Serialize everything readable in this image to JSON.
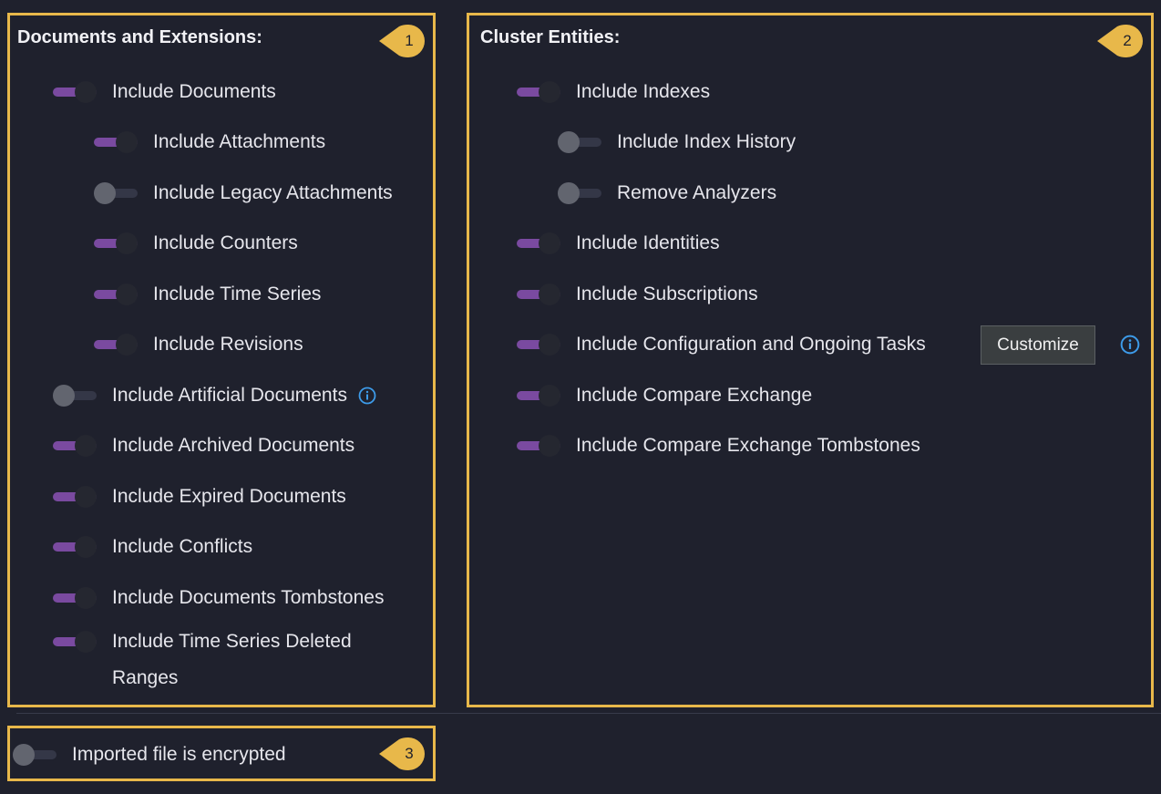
{
  "colors": {
    "background": "#1f212d",
    "highlight_border": "#e8b84a",
    "toggle_on": "#7a4aa0",
    "toggle_off": "#343747",
    "info_icon": "#3d9be9"
  },
  "documents": {
    "title": "Documents and Extensions:",
    "badge": "1",
    "items": [
      {
        "label": "Include Documents",
        "on": true
      },
      {
        "label": "Include Attachments",
        "on": true
      },
      {
        "label": "Include Legacy Attachments",
        "on": false
      },
      {
        "label": "Include Counters",
        "on": true
      },
      {
        "label": "Include Time Series",
        "on": true
      },
      {
        "label": "Include Revisions",
        "on": true
      },
      {
        "label": "Include Artificial Documents",
        "on": false,
        "icon": "info-icon"
      },
      {
        "label": "Include Archived Documents",
        "on": true
      },
      {
        "label": "Include Expired Documents",
        "on": true
      },
      {
        "label": "Include Conflicts",
        "on": true
      },
      {
        "label": "Include Documents Tombstones",
        "on": true
      },
      {
        "label": "Include Time Series Deleted",
        "on": true
      },
      {
        "label": "Ranges"
      }
    ]
  },
  "cluster": {
    "title": "Cluster Entities:",
    "badge": "2",
    "items": [
      {
        "label": "Include Indexes",
        "on": true
      },
      {
        "label": "Include Index History",
        "on": false
      },
      {
        "label": "Remove Analyzers",
        "on": false
      },
      {
        "label": "Include Identities",
        "on": true
      },
      {
        "label": "Include Subscriptions",
        "on": true
      },
      {
        "label": "Include Configuration and Ongoing Tasks",
        "on": true
      },
      {
        "label": "Include Compare Exchange",
        "on": true
      },
      {
        "label": "Include Compare Exchange Tombstones",
        "on": true
      }
    ],
    "customize_label": "Customize",
    "customize_icon": "info-icon"
  },
  "encryption": {
    "badge": "3",
    "label": "Imported file is encrypted",
    "on": false
  }
}
